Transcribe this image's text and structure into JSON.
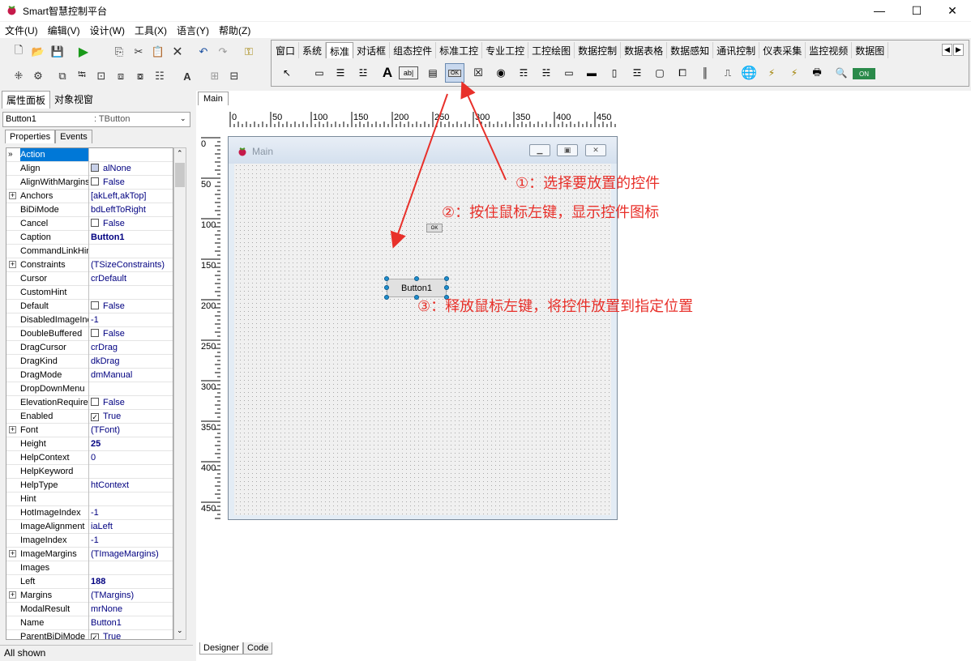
{
  "app": {
    "title": "Smart智慧控制平台"
  },
  "window_buttons": {
    "minimize": "—",
    "maximize": "☐",
    "close": "✕"
  },
  "menu": [
    "文件(U)",
    "编辑(V)",
    "设计(W)",
    "工具(X)",
    "语言(Y)",
    "帮助(Z)"
  ],
  "palette_tabs": [
    "窗口",
    "系统",
    "标准",
    "对话框",
    "组态控件",
    "标准工控",
    "专业工控",
    "工控绘图",
    "数据控制",
    "数据表格",
    "数据感知",
    "通讯控制",
    "仪表采集",
    "监控视频",
    "数据图"
  ],
  "palette_active_tab": "标准",
  "palette_ok_label": "OK",
  "palette_on_label": "ON",
  "left_tabs": [
    "属性面板",
    "对象视窗"
  ],
  "object_selector": {
    "name": "Button1",
    "type": ": TButton"
  },
  "prop_tabs": [
    "Properties",
    "Events"
  ],
  "properties": [
    {
      "name": "Action",
      "value": "",
      "selected": true
    },
    {
      "name": "Align",
      "value": "alNone",
      "icon": true
    },
    {
      "name": "AlignWithMargins",
      "value": "False",
      "check": false
    },
    {
      "name": "Anchors",
      "value": "[akLeft,akTop]",
      "expand": true
    },
    {
      "name": "BiDiMode",
      "value": "bdLeftToRight"
    },
    {
      "name": "Cancel",
      "value": "False",
      "check": false
    },
    {
      "name": "Caption",
      "value": "Button1",
      "bold": true
    },
    {
      "name": "CommandLinkHint",
      "value": ""
    },
    {
      "name": "Constraints",
      "value": "(TSizeConstraints)",
      "expand": true
    },
    {
      "name": "Cursor",
      "value": "crDefault"
    },
    {
      "name": "CustomHint",
      "value": ""
    },
    {
      "name": "Default",
      "value": "False",
      "check": false
    },
    {
      "name": "DisabledImageIndex",
      "value": "-1"
    },
    {
      "name": "DoubleBuffered",
      "value": "False",
      "check": false
    },
    {
      "name": "DragCursor",
      "value": "crDrag"
    },
    {
      "name": "DragKind",
      "value": "dkDrag"
    },
    {
      "name": "DragMode",
      "value": "dmManual"
    },
    {
      "name": "DropDownMenu",
      "value": ""
    },
    {
      "name": "ElevationRequired",
      "value": "False",
      "check": false
    },
    {
      "name": "Enabled",
      "value": "True",
      "check": true
    },
    {
      "name": "Font",
      "value": "(TFont)",
      "expand": true
    },
    {
      "name": "Height",
      "value": "25",
      "bold": true
    },
    {
      "name": "HelpContext",
      "value": "0"
    },
    {
      "name": "HelpKeyword",
      "value": ""
    },
    {
      "name": "HelpType",
      "value": "htContext"
    },
    {
      "name": "Hint",
      "value": ""
    },
    {
      "name": "HotImageIndex",
      "value": "-1"
    },
    {
      "name": "ImageAlignment",
      "value": "iaLeft"
    },
    {
      "name": "ImageIndex",
      "value": "-1"
    },
    {
      "name": "ImageMargins",
      "value": "(TImageMargins)",
      "expand": true
    },
    {
      "name": "Images",
      "value": ""
    },
    {
      "name": "Left",
      "value": "188",
      "bold": true
    },
    {
      "name": "Margins",
      "value": "(TMargins)",
      "expand": true
    },
    {
      "name": "ModalResult",
      "value": "mrNone"
    },
    {
      "name": "Name",
      "value": "Button1"
    },
    {
      "name": "ParentBiDiMode",
      "value": "True",
      "check": true
    }
  ],
  "status": "All shown",
  "designer": {
    "tab": "Main",
    "form_title": "Main",
    "button_caption": "Button1",
    "bottom_tabs": [
      "Designer",
      "Code"
    ]
  },
  "ruler_top_labels": [
    "0",
    "50",
    "100",
    "150",
    "200",
    "250",
    "300",
    "350",
    "400",
    "450"
  ],
  "ruler_left_labels": [
    "0",
    "50",
    "100",
    "150",
    "200",
    "250",
    "300",
    "350",
    "400",
    "450"
  ],
  "annotations": {
    "step1": "①：选择要放置的控件",
    "step2": "②：按住鼠标左键，显示控件图标",
    "step3": "③：释放鼠标左键，将控件放置到指定位置"
  },
  "colors": {
    "annotation": "#e8302a",
    "selection": "#0078d7",
    "handle": "#1f8fd0"
  }
}
